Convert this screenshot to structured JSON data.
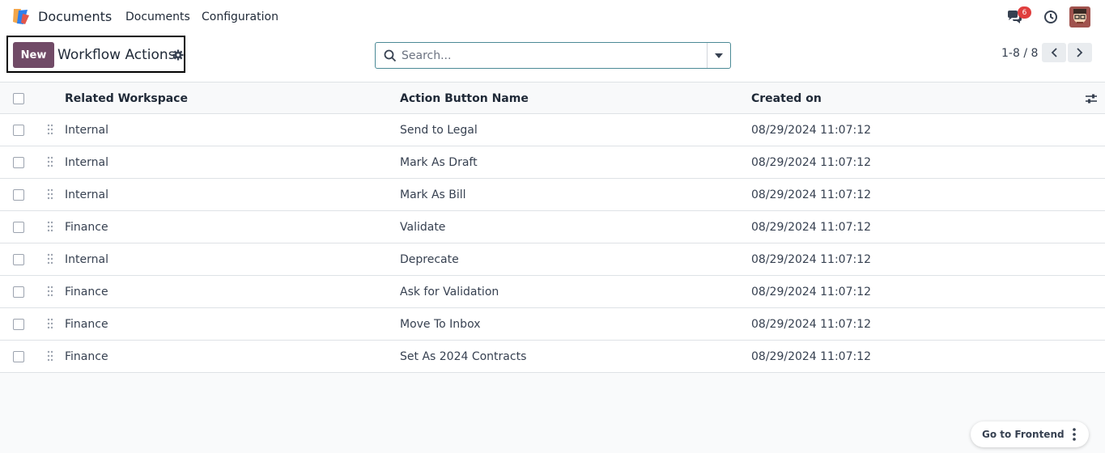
{
  "app": {
    "name": "Documents",
    "menu": [
      "Documents",
      "Configuration"
    ],
    "notification_count": "6"
  },
  "control_panel": {
    "new_label": "New",
    "title": "Workflow Actions",
    "search_placeholder": "Search...",
    "pager": "1-8 / 8"
  },
  "table": {
    "headers": [
      "Related Workspace",
      "Action Button Name",
      "Created on"
    ],
    "rows": [
      [
        "Internal",
        "Send to Legal",
        "08/29/2024 11:07:12"
      ],
      [
        "Internal",
        "Mark As Draft",
        "08/29/2024 11:07:12"
      ],
      [
        "Internal",
        "Mark As Bill",
        "08/29/2024 11:07:12"
      ],
      [
        "Finance",
        "Validate",
        "08/29/2024 11:07:12"
      ],
      [
        "Internal",
        "Deprecate",
        "08/29/2024 11:07:12"
      ],
      [
        "Finance",
        "Ask for Validation",
        "08/29/2024 11:07:12"
      ],
      [
        "Finance",
        "Move To Inbox",
        "08/29/2024 11:07:12"
      ],
      [
        "Finance",
        "Set As 2024 Contracts",
        "08/29/2024 11:07:12"
      ]
    ]
  },
  "footer": {
    "go_to_frontend": "Go to Frontend"
  },
  "colors": {
    "brand": "#714b67",
    "badge": "#e03e3e",
    "search_border": "#4b8a96"
  }
}
